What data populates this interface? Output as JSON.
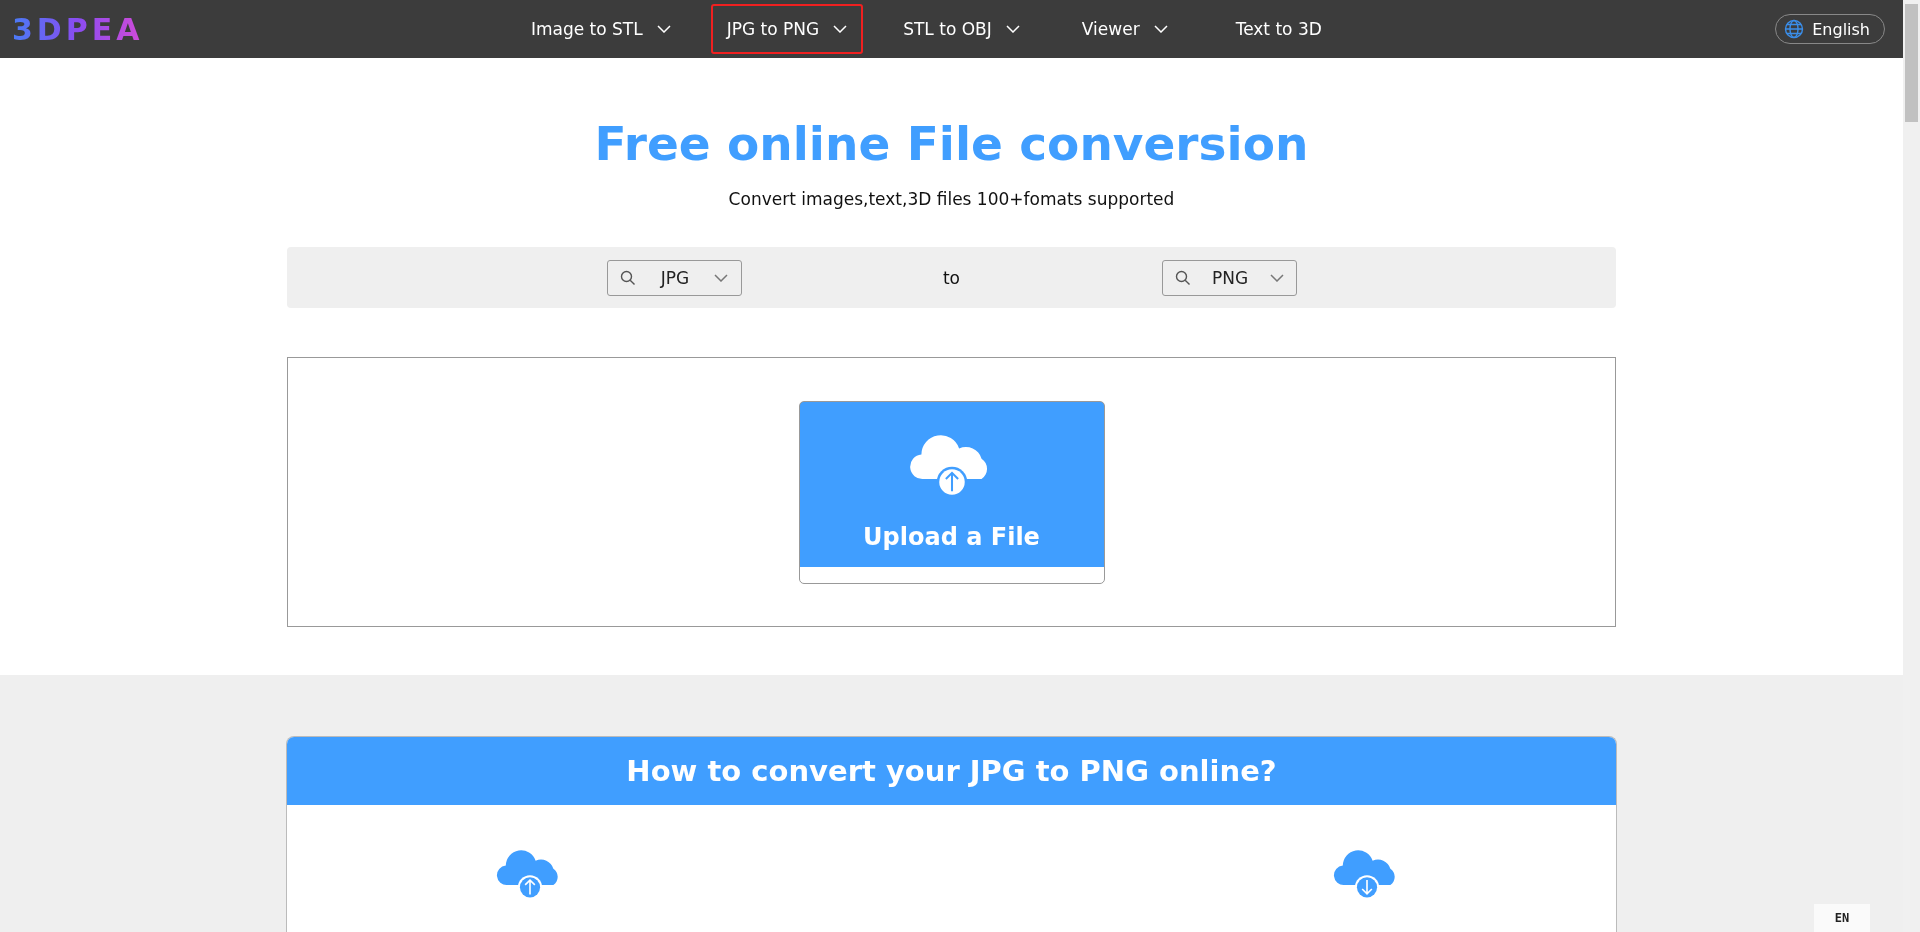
{
  "header": {
    "logo": "3DPEA",
    "nav": [
      {
        "label": "Image to STL",
        "dropdown": true,
        "selected": false
      },
      {
        "label": "JPG to PNG",
        "dropdown": true,
        "selected": true
      },
      {
        "label": "STL to OBJ",
        "dropdown": true,
        "selected": false
      },
      {
        "label": "Viewer",
        "dropdown": true,
        "selected": false
      },
      {
        "label": "Text to 3D",
        "dropdown": false,
        "selected": false
      }
    ],
    "language": "English"
  },
  "hero": {
    "title": "Free online File conversion",
    "subtitle": "Convert images,text,3D files 100+fomats supported"
  },
  "converter": {
    "from": "JPG",
    "separator": "to",
    "to": "PNG"
  },
  "upload": {
    "label": "Upload a File"
  },
  "howto": {
    "title": "How to convert your JPG to PNG online?",
    "steps": [
      {
        "kind": "upload"
      },
      {
        "kind": "download"
      }
    ]
  },
  "ime": {
    "label": "EN"
  }
}
